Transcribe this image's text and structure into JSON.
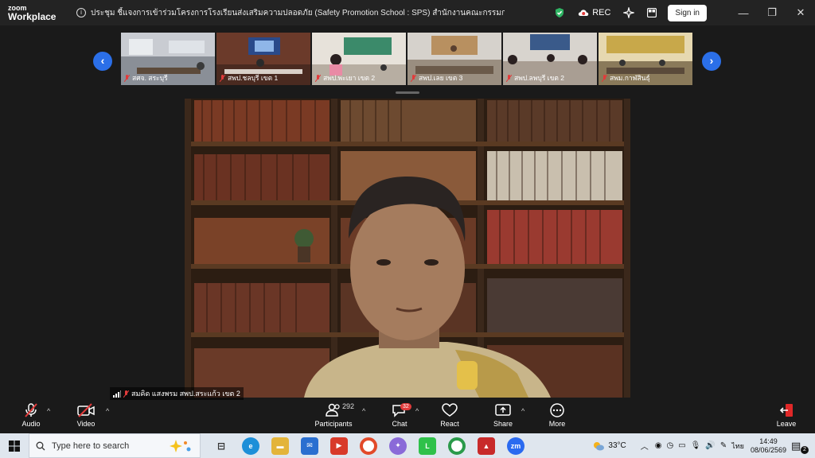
{
  "app": {
    "logo_top": "zoom",
    "logo_bottom": "Workplace",
    "meeting_title": "ประชุม ชี้แจงการเข้าร่วมโครงการโรงเรียนส่งเสริมความปลอดภัย (Safety Promotion School : SPS) สำนักงานคณะกรรมการการศึกษาขั้นพื้นฐาน",
    "rec_label": "REC",
    "signin_label": "Sign in",
    "minimize": "—",
    "restore": "❐",
    "close": "✕"
  },
  "thumbnails": [
    {
      "name": "สศจ. สระบุรี"
    },
    {
      "name": "สพป.ชลบุรี เขต 1"
    },
    {
      "name": "สพป.พะเยา เขต 2"
    },
    {
      "name": "สพป.เลย เขต 3"
    },
    {
      "name": "สพป.ลพบุรี เขต 2"
    },
    {
      "name": "สพม.กาฬสินธุ์"
    }
  ],
  "strip_nav": {
    "prev": "‹",
    "next": "›"
  },
  "main_speaker": {
    "name": "สมคิด แสงพรม สพป.สระแก้ว เขต 2"
  },
  "controls": {
    "audio": "Audio",
    "video": "Video",
    "participants": "Participants",
    "participants_count": "292",
    "chat": "Chat",
    "chat_badge": "32",
    "react": "React",
    "share": "Share",
    "more": "More",
    "leave": "Leave",
    "caret": "^"
  },
  "taskbar": {
    "search_placeholder": "Type here to search",
    "weather": "33°C",
    "lang": "ไทย",
    "time": "14:49",
    "date": "08/06/2569",
    "notif_count": "2"
  },
  "colors": {
    "accent_blue": "#2b6fe8",
    "muted_red": "#e23b3b",
    "leave_red": "#e02828",
    "bg_dark": "#1a1a1a"
  }
}
